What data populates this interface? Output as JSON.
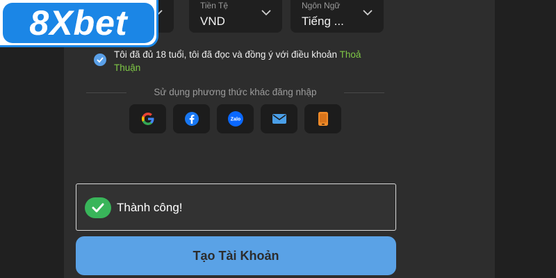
{
  "logo": {
    "text": "8Xbet",
    "brand_color": "#1b86e6"
  },
  "selects": [
    {
      "label": "",
      "value": "",
      "icon": "chevron-down-icon"
    },
    {
      "label": "Tiền Tệ",
      "value": "VND",
      "icon": "chevron-down-icon"
    },
    {
      "label": "Ngôn Ngữ",
      "value": "Tiếng ...",
      "icon": "chevron-down-icon"
    }
  ],
  "terms": {
    "checked": true,
    "text": "Tôi đã đủ 18 tuổi, tôi đã đọc và đồng ý với điều khoản",
    "link_text": "Thoả Thuận",
    "link_color": "#7fc846"
  },
  "divider": {
    "text": "Sử dụng phương thức khác đăng nhập"
  },
  "social": [
    {
      "icon": "google-icon"
    },
    {
      "icon": "facebook-icon"
    },
    {
      "icon": "zalo-icon",
      "text": "Zalo"
    },
    {
      "icon": "email-icon"
    },
    {
      "icon": "phone-icon"
    }
  ],
  "toast": {
    "text": "Thành công!",
    "status_color": "#39b55a"
  },
  "submit": {
    "label": "Tạo Tài Khoản",
    "color": "#5aa2e6"
  }
}
